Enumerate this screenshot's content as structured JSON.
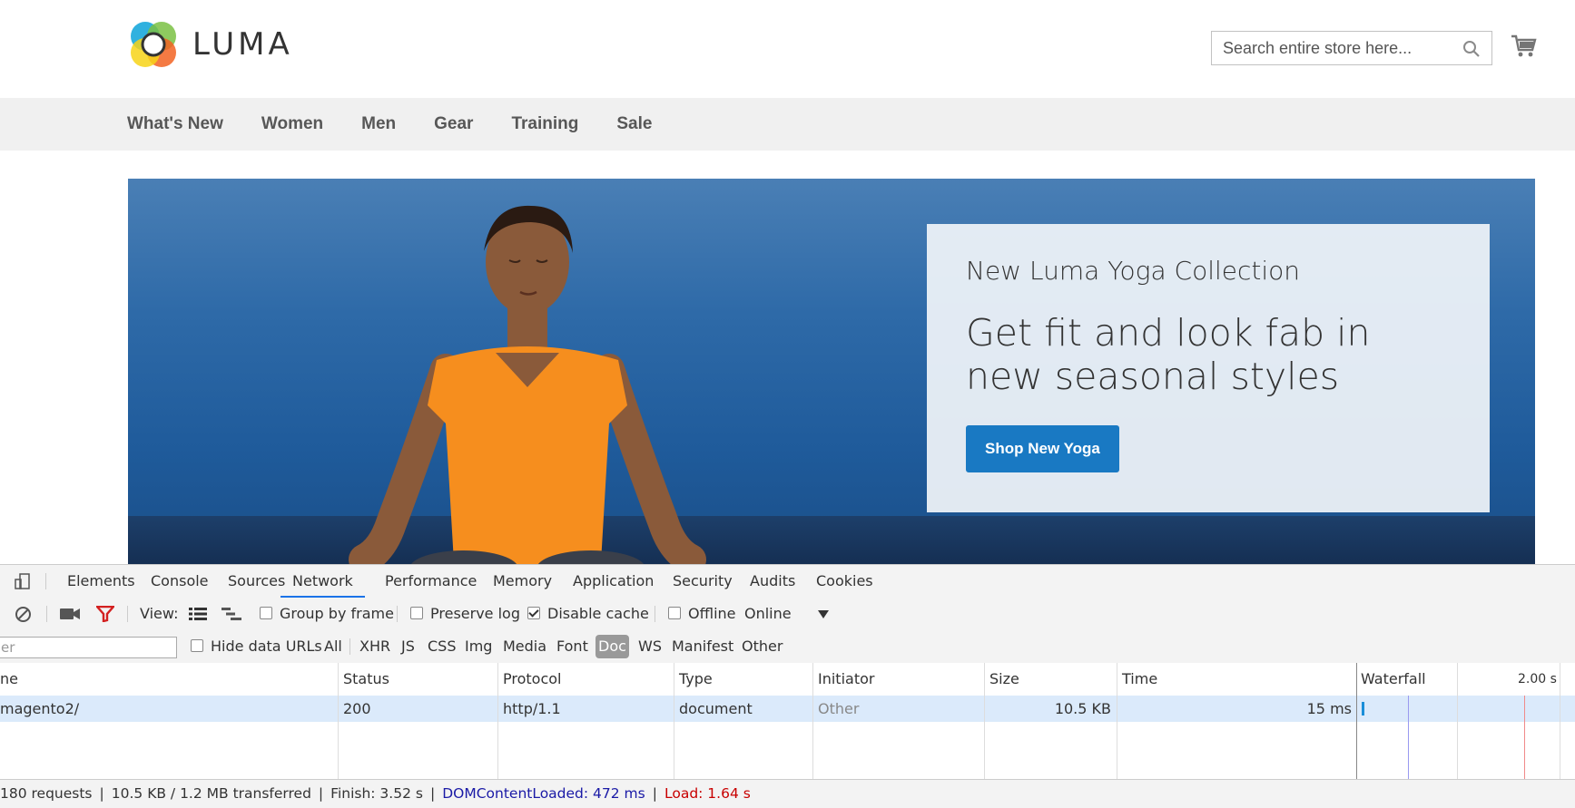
{
  "store": {
    "logo_text": "LUMA",
    "search_placeholder": "Search entire store here...",
    "nav": [
      "What's New",
      "Women",
      "Men",
      "Gear",
      "Training",
      "Sale"
    ]
  },
  "hero": {
    "kicker": "New Luma Yoga Collection",
    "headline": "Get fit and look fab in new seasonal styles",
    "cta_label": "Shop New Yoga"
  },
  "devtools": {
    "tabs": [
      "Elements",
      "Console",
      "Sources",
      "Network",
      "Performance",
      "Memory",
      "Application",
      "Security",
      "Audits",
      "Cookies"
    ],
    "active_tab": "Network",
    "toolbar": {
      "view_label": "View:",
      "group_by_frame": "Group by frame",
      "preserve_log": "Preserve log",
      "disable_cache": "Disable cache",
      "offline": "Offline",
      "throttle_value": "Online"
    },
    "filter": {
      "input_value": "er",
      "hide_data_urls": "Hide data URLs",
      "types": [
        "All",
        "XHR",
        "JS",
        "CSS",
        "Img",
        "Media",
        "Font",
        "Doc",
        "WS",
        "Manifest",
        "Other"
      ],
      "active_type": "Doc"
    },
    "columns": [
      "ne",
      "Status",
      "Protocol",
      "Type",
      "Initiator",
      "Size",
      "Time",
      "Waterfall"
    ],
    "waterfall_tick": "2.00 s",
    "rows": [
      {
        "name": "magento2/",
        "status": "200",
        "protocol": "http/1.1",
        "type": "document",
        "initiator": "Other",
        "size": "10.5 KB",
        "time": "15 ms"
      }
    ],
    "status_bar": {
      "requests": "180 requests",
      "transferred": "10.5 KB / 1.2 MB transferred",
      "finish": "Finish: 3.52 s",
      "dom_content_loaded": "DOMContentLoaded: 472 ms",
      "load": "Load: 1.64 s"
    }
  },
  "colors": {
    "accent_button": "#1979c3",
    "devtools_active_tab": "#1a73e8",
    "dcl_blue": "#1a1aa6",
    "load_red": "#c80000"
  }
}
